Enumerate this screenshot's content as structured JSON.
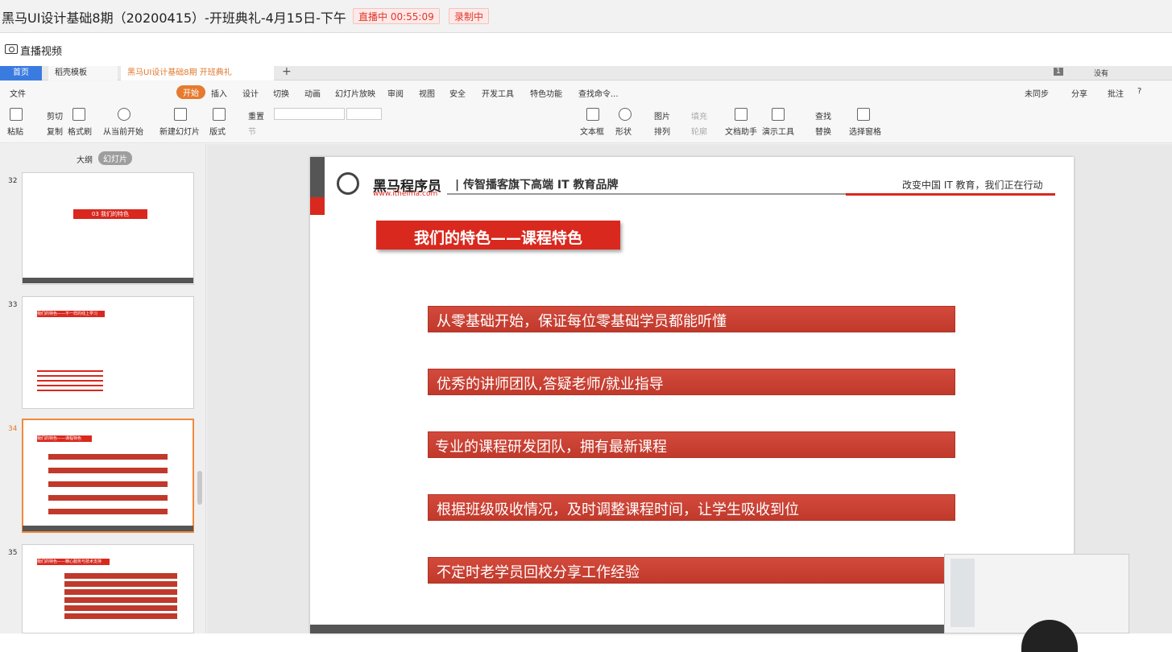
{
  "window": {
    "title": "黑马UI设计基础8期（20200415）-开班典礼-4月15日-下午",
    "live_badge": "直播中 00:55:09",
    "record_badge": "录制中",
    "live_label": "直播视频"
  },
  "wps": {
    "tabs": [
      "首页",
      "稻壳模板",
      "黑马UI设计基础8期 开班典礼"
    ],
    "add_tab": "+",
    "menu": [
      "文件",
      "开始",
      "插入",
      "设计",
      "切换",
      "动画",
      "幻灯片放映",
      "审阅",
      "视图",
      "安全",
      "开发工具",
      "特色功能",
      "查找命令..."
    ],
    "right_menu": [
      "未同步",
      "分享",
      "批注",
      "?"
    ],
    "tools": [
      "粘贴",
      "剪切",
      "复制",
      "格式刷",
      "从当前开始",
      "新建幻灯片",
      "版式",
      "节",
      "重置",
      "文本框",
      "形状",
      "图片",
      "排列",
      "填充",
      "轮廓",
      "文档助手",
      "演示工具",
      "查找",
      "替换",
      "选择窗格"
    ],
    "panel_tabs": [
      "大纲",
      "幻灯片"
    ],
    "right_status": [
      "1",
      "没有"
    ]
  },
  "thumbs": [
    {
      "num": "32",
      "title": "03    我们的特色"
    },
    {
      "num": "33",
      "title": "我们的特色——不一样的线上学习"
    },
    {
      "num": "34",
      "title": "我们的特色——课程特色"
    },
    {
      "num": "35",
      "title": "我们的特色——精心服务与技术支持"
    }
  ],
  "slide": {
    "brand": "黑马程序员",
    "url": "www.itheima.com",
    "slogan": "| 传智播客旗下高端 IT 教育品牌",
    "motto": "改变中国 IT 教育，我们正在行动",
    "heading": "我们的特色——课程特色",
    "features": [
      "从零基础开始，保证每位零基础学员都能听懂",
      "优秀的讲师团队,答疑老师/就业指导",
      "专业的课程研发团队，拥有最新课程",
      "根据班级吸收情况，及时调整课程时间，让学生吸收到位",
      "不定时老学员回校分享工作经验"
    ]
  },
  "colors": {
    "accent": "#d9281e",
    "tab_blue": "#3a7be0",
    "start_orange": "#e67a2e"
  }
}
